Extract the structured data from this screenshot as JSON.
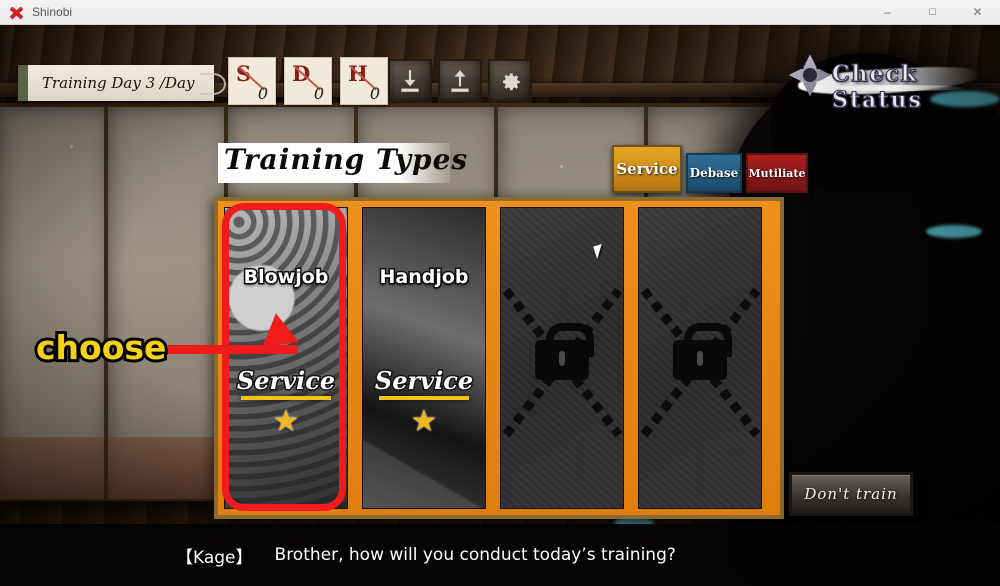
{
  "window": {
    "title": "Shinobi",
    "app_icon": "shuriken-x-icon",
    "controls": {
      "minimize": "–",
      "maximize": "☐",
      "close": "✕"
    }
  },
  "hud": {
    "day_scroll": "Training Day   3 /Day",
    "stats": [
      {
        "letter": "S",
        "value": "0"
      },
      {
        "letter": "D",
        "value": "0"
      },
      {
        "letter": "H",
        "value": "0"
      }
    ],
    "buttons": [
      {
        "name": "save-button",
        "icon": "download-icon"
      },
      {
        "name": "load-button",
        "icon": "upload-icon"
      },
      {
        "name": "settings-button",
        "icon": "gear-icon"
      }
    ],
    "check_status": {
      "label": "Check Status",
      "icon": "shuriken-icon"
    }
  },
  "main": {
    "heading": "Training Types",
    "tabs": [
      {
        "label": "Service",
        "color": "#e6a623",
        "active": true
      },
      {
        "label": "Debase",
        "color": "#2f6e97",
        "active": false
      },
      {
        "label": "Mutiliate",
        "color": "#a82020",
        "active": false
      }
    ],
    "cards": [
      {
        "title": "Blowjob",
        "category": "Service",
        "stars": "★",
        "locked": false,
        "selected": true
      },
      {
        "title": "Handjob",
        "category": "Service",
        "stars": "★",
        "locked": false,
        "selected": false
      },
      {
        "title": "",
        "category": "",
        "stars": "",
        "locked": true,
        "selected": false
      },
      {
        "title": "",
        "category": "",
        "stars": "",
        "locked": true,
        "selected": false
      }
    ],
    "dont_train_label": "Don't train"
  },
  "annotation": {
    "label": "choose",
    "arrow": "red-arrow-right",
    "highlight_color": "#f21b1b",
    "label_color": "#f5d313"
  },
  "dialogue": {
    "speaker": "【Kage】",
    "text": "Brother, how will you conduct today’s training?"
  }
}
